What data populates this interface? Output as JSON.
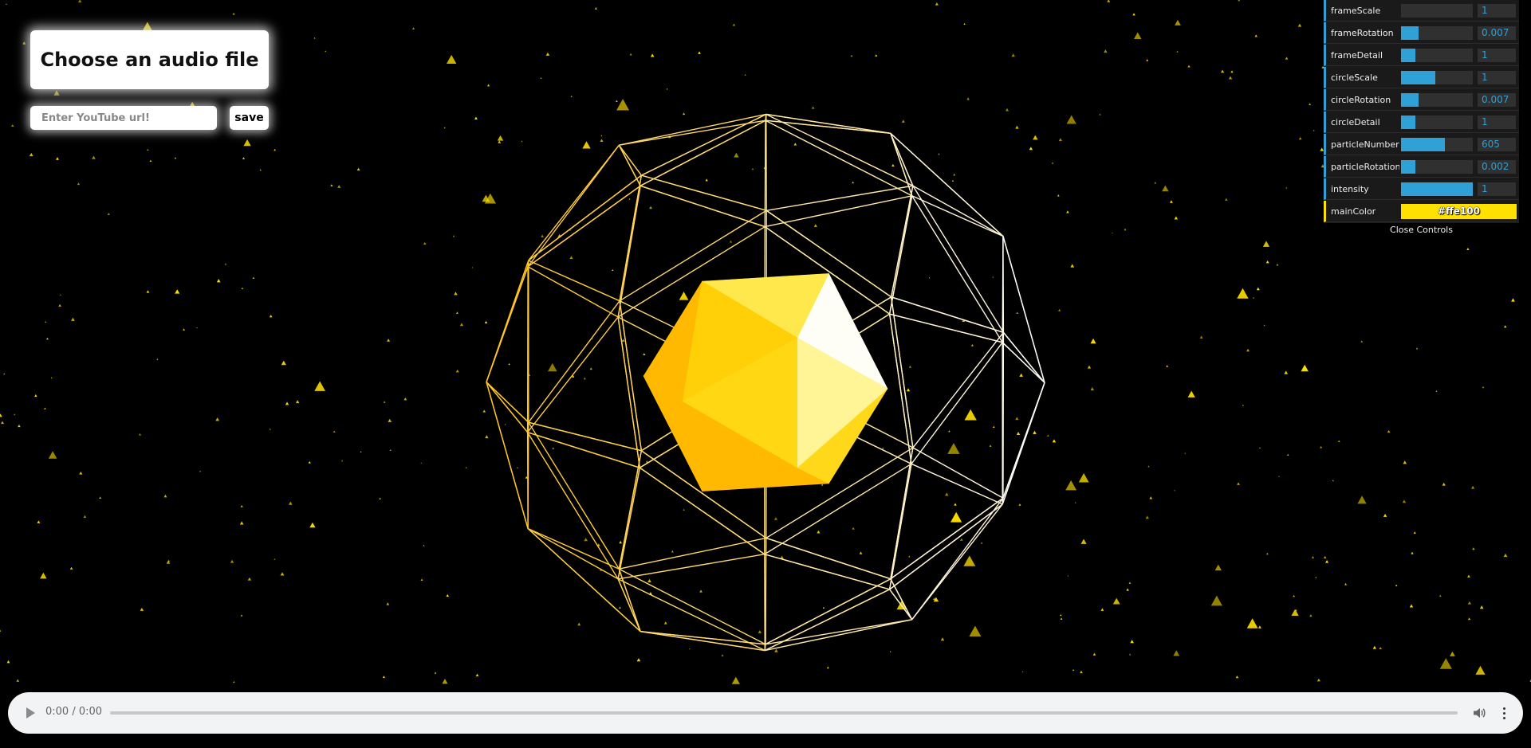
{
  "visualizer": {
    "main_color": "#ffe100",
    "background_color": "#000000"
  },
  "upload": {
    "label": "Choose an audio file"
  },
  "youtube": {
    "placeholder": "Enter YouTube url!",
    "save_label": "save"
  },
  "controls": {
    "close_label": "Close Controls",
    "sliders": [
      {
        "label": "frameScale",
        "value": "1",
        "fill_fraction": 0.0
      },
      {
        "label": "frameRotation",
        "value": "0.007",
        "fill_fraction": 0.24
      },
      {
        "label": "frameDetail",
        "value": "1",
        "fill_fraction": 0.2
      },
      {
        "label": "circleScale",
        "value": "1",
        "fill_fraction": 0.48
      },
      {
        "label": "circleRotation",
        "value": "0.007",
        "fill_fraction": 0.24
      },
      {
        "label": "circleDetail",
        "value": "1",
        "fill_fraction": 0.2
      },
      {
        "label": "particleNumber",
        "value": "605",
        "fill_fraction": 0.61
      },
      {
        "label": "particleRotation",
        "value": "0.002",
        "fill_fraction": 0.2
      },
      {
        "label": "intensity",
        "value": "1",
        "fill_fraction": 1.0
      }
    ],
    "color": {
      "label": "mainColor",
      "value": "#ffe100"
    }
  },
  "audio_player": {
    "time": "0:00 / 0:00",
    "progress_fraction": 0,
    "play_icon": "play-icon",
    "volume_icon": "volume-icon",
    "more_icon": "more-options-icon"
  }
}
